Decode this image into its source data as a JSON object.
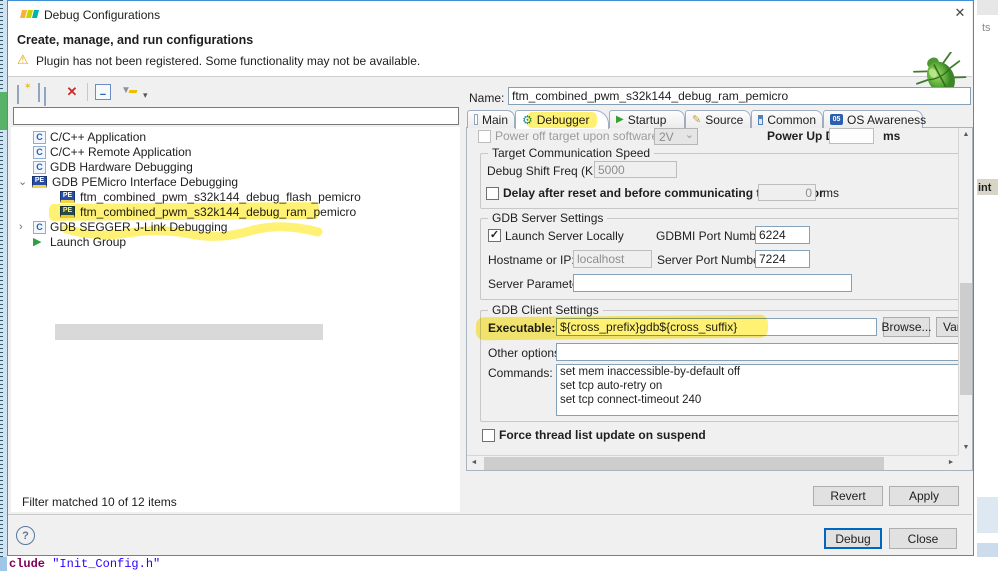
{
  "window": {
    "title": "Debug Configurations",
    "close_glyph": "✕"
  },
  "header": {
    "title": "Create, manage, and run configurations",
    "warning": "Plugin has not been registered. Some functionality may not be available.",
    "warning_glyph": "⚠"
  },
  "toolbar": {
    "delete_glyph": "✕",
    "collapse_glyph": "−",
    "dropdown_glyph": "▾",
    "new_star_glyph": "✶",
    "filter_glyph": "▼"
  },
  "left": {
    "filter_value": "",
    "status": "Filter matched 10 of 12 items",
    "tree": [
      {
        "label": "C/C++ Application"
      },
      {
        "label": "C/C++ Remote Application"
      },
      {
        "label": "GDB Hardware Debugging"
      },
      {
        "label": "GDB PEMicro Interface Debugging",
        "expander": "⌄"
      },
      {
        "label": "ftm_combined_pwm_s32k144_debug_flash_pemicro"
      },
      {
        "label": "ftm_combined_pwm_s32k144_debug_ram_pemicro"
      },
      {
        "label": "GDB SEGGER J-Link Debugging",
        "expander": "›"
      },
      {
        "label": "Launch Group"
      }
    ],
    "icon_c": "C",
    "icon_pe": "PE",
    "icon_play": "▶"
  },
  "form": {
    "name_label": "Name:",
    "name_value": "ftm_combined_pwm_s32k144_debug_ram_pemicro",
    "tabs": [
      {
        "label": "Main"
      },
      {
        "label": "Debugger"
      },
      {
        "label": "Startup"
      },
      {
        "label": "Source"
      },
      {
        "label": "Common"
      },
      {
        "label": "OS Awareness"
      }
    ],
    "os_icon_text": "05",
    "power": {
      "checkbox_label": "Power off target upon software exit",
      "voltage_value": "2V",
      "delay_label": "Power Up Delay",
      "delay_value": "",
      "unit": "ms"
    },
    "speed": {
      "title": "Target Communication Speed",
      "freq_label": "Debug Shift Freq (KHz)",
      "freq_value": "5000",
      "delay_checkbox_label": "Delay after reset and before communicating to target for",
      "delay_value": "0",
      "delay_unit": "ms"
    },
    "server": {
      "title": "GDB Server Settings",
      "launch_label": "Launch Server Locally",
      "gdbmi_label": "GDBMI Port Number:",
      "gdbmi_value": "6224",
      "host_label": "Hostname or IP:",
      "host_value": "localhost",
      "port_label": "Server Port Number:",
      "port_value": "7224",
      "params_label": "Server Parameters:",
      "params_value": ""
    },
    "client": {
      "title": "GDB Client Settings",
      "exec_label": "Executable:",
      "exec_value": "${cross_prefix}gdb${cross_suffix}",
      "browse_label": "Browse...",
      "variables_label": "Varia",
      "other_label": "Other options:",
      "other_value": "",
      "commands_label": "Commands:",
      "commands_value": "set mem inaccessible-by-default off\nset tcp auto-retry on\nset tcp connect-timeout 240"
    },
    "force_label": "Force thread list update on suspend",
    "revert_label": "Revert",
    "apply_label": "Apply"
  },
  "footer": {
    "help_glyph": "?",
    "debug_label": "Debug",
    "close_label": "Close"
  },
  "background": {
    "right_top_text": "ts",
    "right_mid_text": "int",
    "code_prefix": "clude ",
    "code_string": "\"Init_Config.h\""
  },
  "glyphs": {
    "check": "✓",
    "chevron_down": "⌄",
    "up": "▲",
    "down": "▼",
    "left": "◄",
    "right": "►"
  },
  "colors": {
    "accent_blue": "#3f8fd6",
    "marker_yellow": "#ffe816",
    "warning_orange": "#e8a000"
  }
}
